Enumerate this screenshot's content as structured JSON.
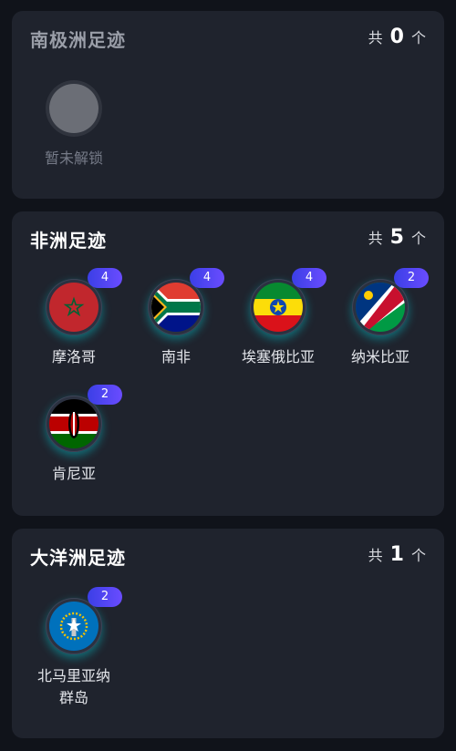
{
  "antarctica": {
    "title": "南极洲足迹",
    "prefix": "共",
    "count": "0",
    "suffix": "个",
    "locked_label": "暂未解锁"
  },
  "africa": {
    "title": "非洲足迹",
    "prefix": "共",
    "count": "5",
    "suffix": "个",
    "items": [
      {
        "name": "摩洛哥",
        "badge": "4"
      },
      {
        "name": "南非",
        "badge": "4"
      },
      {
        "name": "埃塞俄比亚",
        "badge": "4"
      },
      {
        "name": "纳米比亚",
        "badge": "2"
      },
      {
        "name": "肯尼亚",
        "badge": "2"
      }
    ]
  },
  "oceania": {
    "title": "大洋洲足迹",
    "prefix": "共",
    "count": "1",
    "suffix": "个",
    "items": [
      {
        "name_line1": "北马里亚纳",
        "name_line2": "群岛",
        "badge": "2"
      }
    ]
  }
}
